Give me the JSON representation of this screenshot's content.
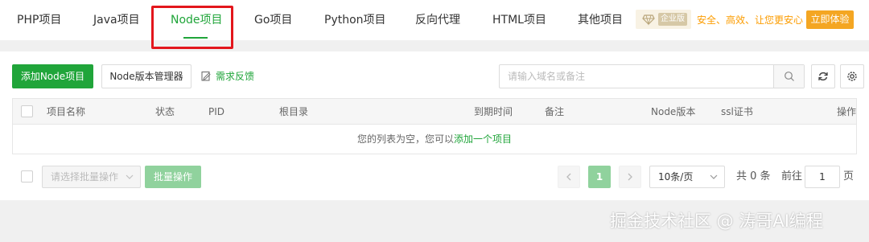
{
  "tabs": [
    {
      "label": "PHP项目"
    },
    {
      "label": "Java项目"
    },
    {
      "label": "Node项目",
      "active": true
    },
    {
      "label": "Go项目"
    },
    {
      "label": "Python项目"
    },
    {
      "label": "反向代理"
    },
    {
      "label": "HTML项目"
    },
    {
      "label": "其他项目"
    }
  ],
  "enterprise": {
    "badge": "企业版",
    "slogan": "安全、高效、让您更安心",
    "try_button": "立即体验"
  },
  "toolbar": {
    "add_button": "添加Node项目",
    "version_manager_button": "Node版本管理器",
    "feedback_link": "需求反馈"
  },
  "search": {
    "placeholder": "请输入域名或备注",
    "value": ""
  },
  "table": {
    "columns": [
      "项目名称",
      "状态",
      "PID",
      "根目录",
      "到期时间",
      "备注",
      "Node版本",
      "ssl证书",
      "操作"
    ],
    "empty_text": "您的列表为空，您可以",
    "empty_link": "添加一个项目"
  },
  "footer": {
    "batch_select_placeholder": "请选择批量操作",
    "batch_button": "批量操作",
    "current_page": "1",
    "page_size": "10条/页",
    "total": "共 0 条",
    "goto_label": "前往",
    "goto_value": "1",
    "page_suffix": "页"
  },
  "watermark": "掘金技术社区 @ 涛哥AI编程",
  "colors": {
    "accent": "#20a53a",
    "highlight_box": "#e3161c",
    "enterprise_orange": "#fc9c00"
  }
}
